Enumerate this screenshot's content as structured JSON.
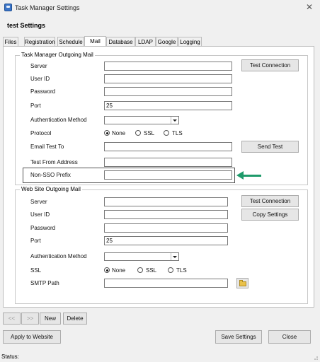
{
  "window": {
    "title": "Task Manager Settings",
    "close_glyph": "✕"
  },
  "header": {
    "subtitle": "test Settings"
  },
  "tabs": [
    {
      "label": "Files"
    },
    {
      "label": "Registration"
    },
    {
      "label": "Schedule"
    },
    {
      "label": "Mail",
      "active": true
    },
    {
      "label": "Database"
    },
    {
      "label": "LDAP"
    },
    {
      "label": "Google"
    },
    {
      "label": "Logging"
    }
  ],
  "outgoing": {
    "group_title": "Task Manager Outgoing Mail",
    "server_label": "Server",
    "server_value": "",
    "userid_label": "User ID",
    "userid_value": "",
    "password_label": "Password",
    "password_value": "",
    "port_label": "Port",
    "port_value": "25",
    "auth_label": "Authentication Method",
    "auth_value": "",
    "protocol_label": "Protocol",
    "protocol_options": [
      "None",
      "SSL",
      "TLS"
    ],
    "protocol_selected": "None",
    "email_test_label": "Email Test To",
    "email_test_value": "",
    "from_label": "Test From Address",
    "from_value": "",
    "nonsso_label": "Non-SSO Prefix",
    "nonsso_value": "",
    "test_connection_label": "Test Connection",
    "send_test_label": "Send Test"
  },
  "website": {
    "group_title": "Web Site Outgoing Mail",
    "server_label": "Server",
    "server_value": "",
    "userid_label": "User ID",
    "userid_value": "",
    "password_label": "Password",
    "password_value": "",
    "port_label": "Port",
    "port_value": "25",
    "auth_label": "Authentication Method",
    "auth_value": "",
    "ssl_label": "SSL",
    "ssl_options": [
      "None",
      "SSL",
      "TLS"
    ],
    "ssl_selected": "None",
    "smtp_label": "SMTP Path",
    "smtp_value": "",
    "test_connection_label": "Test Connection",
    "copy_settings_label": "Copy Settings"
  },
  "nav": {
    "prev_label": "<<",
    "next_label": ">>",
    "new_label": "New",
    "delete_label": "Delete"
  },
  "footer": {
    "apply_label": "Apply to Website",
    "save_label": "Save Settings",
    "close_label": "Close",
    "status_label": "Status:"
  },
  "colors": {
    "arrow": "#1e9a6a",
    "highlight_border": "#555555"
  },
  "icons": {
    "app": "app-icon",
    "close": "close-icon",
    "folder": "folder-icon",
    "arrow": "arrow-left-icon"
  }
}
